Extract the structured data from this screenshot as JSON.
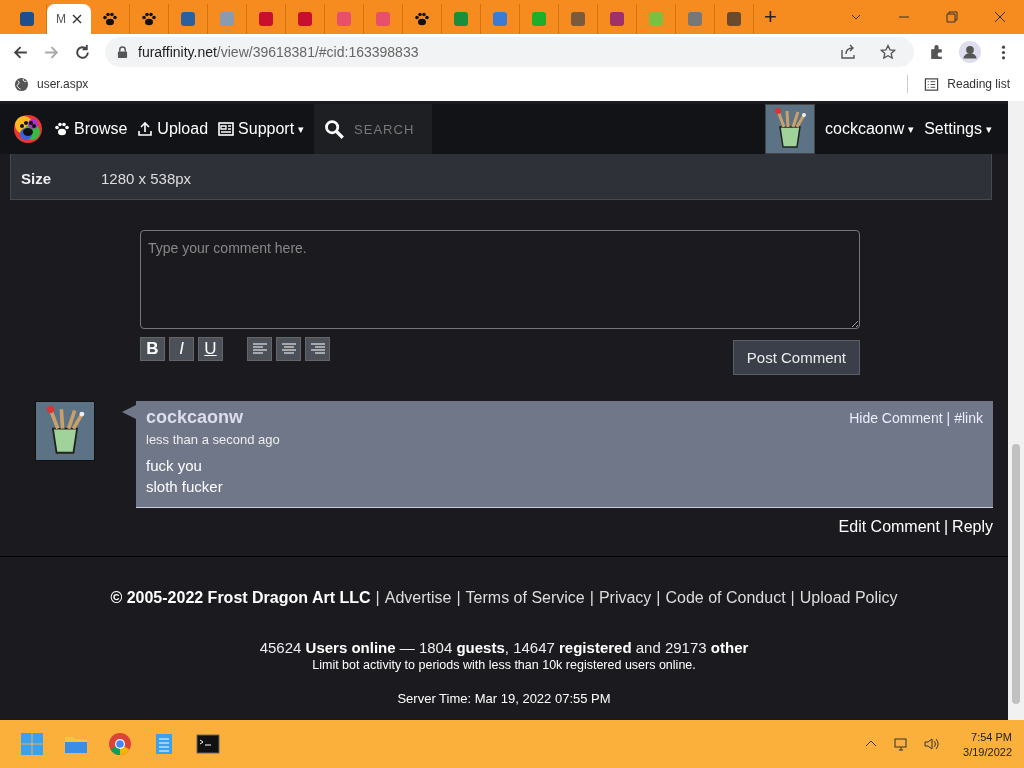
{
  "browser": {
    "tabs": [
      {
        "kind": "favicon",
        "color": "#1f4e8c",
        "selected": false
      },
      {
        "kind": "blank",
        "title": "M",
        "selected": true
      },
      {
        "kind": "paw",
        "color": "#111111",
        "selected": false
      },
      {
        "kind": "paw",
        "color": "#111111",
        "selected": false
      },
      {
        "kind": "favicon",
        "color": "#2a5fa0",
        "selected": false
      },
      {
        "kind": "favicon",
        "color": "#8a9bb0",
        "selected": false
      },
      {
        "kind": "favicon",
        "color": "#c8102e",
        "selected": false
      },
      {
        "kind": "favicon",
        "color": "#c8102e",
        "selected": false
      },
      {
        "kind": "favicon",
        "color": "#e8506a",
        "selected": false
      },
      {
        "kind": "favicon",
        "color": "#e8506a",
        "selected": false
      },
      {
        "kind": "paw",
        "color": "#111111",
        "selected": false
      },
      {
        "kind": "favicon",
        "color": "#1a8f3a",
        "selected": false
      },
      {
        "kind": "favicon",
        "color": "#3a7bd5",
        "selected": false
      },
      {
        "kind": "favicon",
        "color": "#1fae2a",
        "selected": false
      },
      {
        "kind": "favicon",
        "color": "#7a5a3a",
        "selected": false
      },
      {
        "kind": "favicon",
        "color": "#a0306a",
        "selected": false
      },
      {
        "kind": "favicon",
        "color": "#7ac142",
        "selected": false
      },
      {
        "kind": "favicon",
        "color": "#777777",
        "selected": false
      },
      {
        "kind": "favicon",
        "color": "#6a4a2a",
        "selected": false
      }
    ],
    "new_tab": "+",
    "address": {
      "host": "furaffinity.net",
      "path": "/view/39618381/#cid:163398833"
    },
    "bookmark": "user.aspx",
    "reading_list": "Reading list"
  },
  "nav": {
    "caret": "▾",
    "items": [
      "Browse",
      "Upload",
      "Support"
    ],
    "search_placeholder": "SEARCH",
    "username": "cockcaonw",
    "settings": "Settings"
  },
  "details": [
    {
      "label": "Size",
      "value": "1280 x 538px"
    }
  ],
  "comment_form": {
    "placeholder": "Type your comment here.",
    "format_buttons": [
      "B",
      "I",
      "U"
    ],
    "submit": "Post Comment"
  },
  "comments": [
    {
      "separator": "|",
      "author": "cockcaonw",
      "time": "less than a second ago",
      "lines": [
        "fuck you",
        "sloth fucker"
      ],
      "hide": "Hide Comment",
      "link": "#link",
      "edit": "Edit Comment",
      "reply": "Reply"
    }
  ],
  "footer": {
    "separator": "|",
    "copyright": "© 2005-2022 Frost Dragon Art LLC",
    "links": [
      "Advertise",
      "Terms of Service",
      "Privacy",
      "Code of Conduct",
      "Upload Policy"
    ],
    "stats": "45624 **Users online** — 1804 **guests**, 14647 **registered** and 29173 **other**",
    "note": "Limit bot activity to periods with less than 10k registered users online.",
    "server_time": "Server Time: Mar 19, 2022 07:55 PM"
  },
  "taskbar": {
    "time": "7:54 PM",
    "date": "3/19/2022"
  }
}
